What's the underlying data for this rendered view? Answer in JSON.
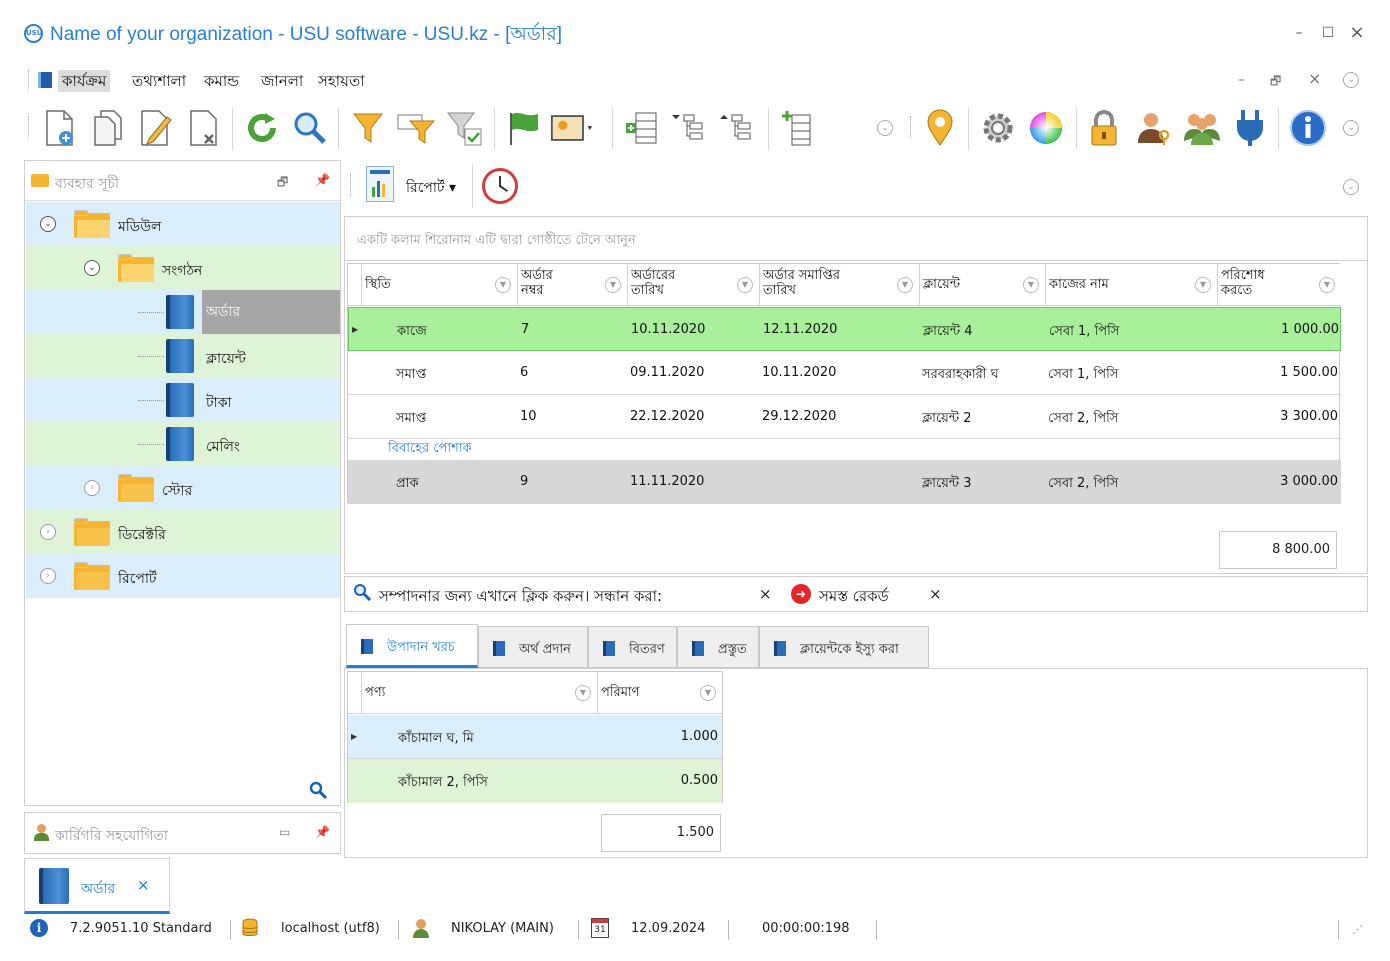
{
  "window": {
    "title": "Name of your organization - USU software - USU.kz - [অর্ডার]",
    "logo_text": "USU",
    "minimize": "–",
    "maximize": "☐",
    "close": "×"
  },
  "menu": {
    "items": [
      "কার্যক্রম",
      "তথ্যশালা",
      "কমান্ড",
      "জানলা",
      "সহায়তা"
    ],
    "mdi_minimize": "–",
    "mdi_restore": "🗗",
    "mdi_close": "×"
  },
  "left_panel": {
    "title": "ব্যবহার সূচী",
    "tree": [
      {
        "label": "মডিউল",
        "level": 0
      },
      {
        "label": "সংগঠন",
        "level": 1
      },
      {
        "label": "অর্ডার",
        "level": 2
      },
      {
        "label": "ক্লায়েন্ট",
        "level": 2
      },
      {
        "label": "টাকা",
        "level": 2
      },
      {
        "label": "মেলিং",
        "level": 2
      },
      {
        "label": "স্টোর",
        "level": 1
      },
      {
        "label": "ডিরেক্টরি",
        "level": 0
      },
      {
        "label": "রিপোর্ট",
        "level": 0
      }
    ]
  },
  "collab_panel": {
    "title": "কার্রিগরি সহযোগিতা"
  },
  "report_toolbar": {
    "report_label": "রিপোর্ট ▾"
  },
  "grid": {
    "group_hint": "একটি কলাম শিরোনাম এটি দ্বারা গোষ্ঠীতে টেনে আনুন",
    "columns": [
      {
        "l1": "স্থিতি",
        "l2": ""
      },
      {
        "l1": "অর্ডার",
        "l2": "নম্বর"
      },
      {
        "l1": "অর্ডারের",
        "l2": "তারিখ"
      },
      {
        "l1": "অর্ডার সমাপ্তির",
        "l2": "তারিখ"
      },
      {
        "l1": "ক্লায়েন্ট",
        "l2": ""
      },
      {
        "l1": "কাজের নাম",
        "l2": ""
      },
      {
        "l1": "পরিশোধ",
        "l2": "করতে"
      }
    ],
    "rows": [
      {
        "status": "কাজে",
        "num": "7",
        "date": "10.11.2020",
        "end": "12.11.2020",
        "client": "ক্লায়েন্ট 4",
        "job": "সেবা 1, পিসি",
        "amount": "1 000.00"
      },
      {
        "status": "সমাপ্ত",
        "num": "6",
        "date": "09.11.2020",
        "end": "10.11.2020",
        "client": "সরবরাহকারী ঘ",
        "job": "সেবা 1, পিসি",
        "amount": "1 500.00"
      },
      {
        "status": "সমাপ্ত",
        "num": "10",
        "date": "22.12.2020",
        "end": "29.12.2020",
        "client": "ক্লায়েন্ট 2",
        "job": "সেবা 2, পিসি",
        "amount": "3 300.00"
      },
      {
        "status": "প্রাক",
        "num": "9",
        "date": "11.11.2020",
        "end": "",
        "client": "ক্লায়েন্ট 3",
        "job": "সেবা 2, পিসি",
        "amount": "3 000.00"
      }
    ],
    "group_row_label": "বিবাহের পোশাক",
    "total": "8 800.00"
  },
  "findbar": {
    "label": "সম্পাদনার জন্য এখানে ক্লিক করুন। সন্ধান করা:",
    "clear": "×",
    "all_records": "সমস্ত রেকর্ড",
    "clear2": "×"
  },
  "tabs": [
    "উপাদান খরচ",
    "অর্থ প্রদান",
    "বিতরণ",
    "প্রস্তুত",
    "ক্লায়েন্টকে ইস্যু করা"
  ],
  "sub_grid": {
    "columns": [
      "পণ্য",
      "পরিমাণ"
    ],
    "rows": [
      {
        "product": "কাঁচামাল ঘ, মি",
        "qty": "1.000"
      },
      {
        "product": "কাঁচামাল 2, পিসি",
        "qty": "0.500"
      }
    ],
    "total": "1.500"
  },
  "doc_tab": {
    "label": "অর্ডার",
    "close": "×"
  },
  "status": {
    "version": "7.2.9051.10 Standard",
    "db": "localhost (utf8)",
    "user": "NIKOLAY (MAIN)",
    "calendar_day": "31",
    "date": "12.09.2024",
    "timer": "00:00:00:198"
  }
}
